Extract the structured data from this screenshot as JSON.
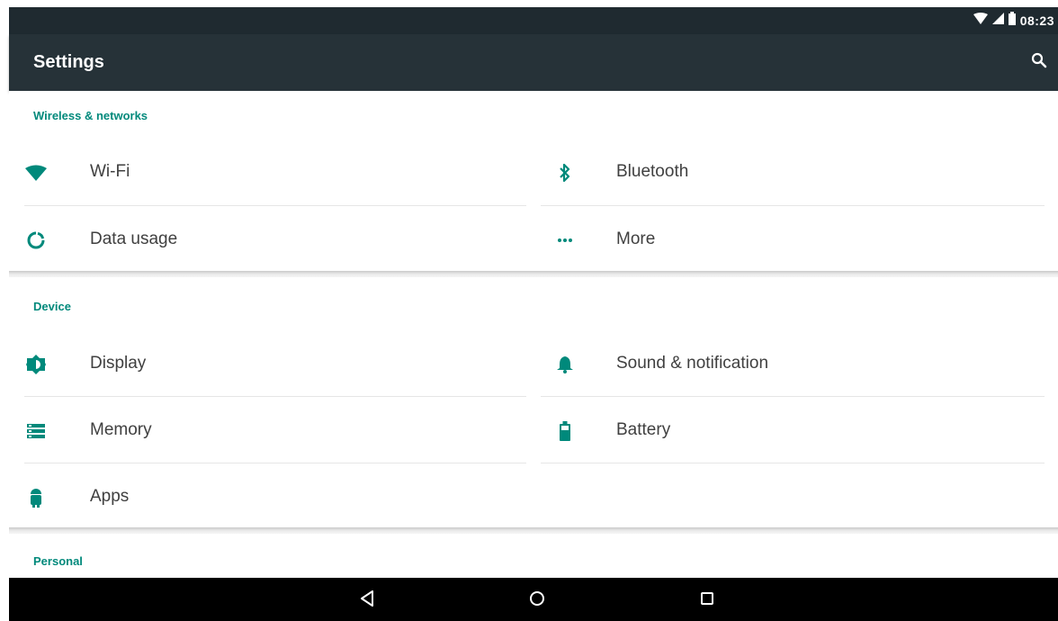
{
  "status": {
    "time": "08:23"
  },
  "app_bar": {
    "title": "Settings"
  },
  "sections": {
    "wireless": {
      "header": "Wireless & networks",
      "items": [
        {
          "label": "Wi-Fi",
          "icon": "wifi-icon"
        },
        {
          "label": "Bluetooth",
          "icon": "bluetooth-icon"
        },
        {
          "label": "Data usage",
          "icon": "data-usage-icon"
        },
        {
          "label": "More",
          "icon": "more-icon"
        }
      ]
    },
    "device": {
      "header": "Device",
      "items": [
        {
          "label": "Display",
          "icon": "display-brightness-icon"
        },
        {
          "label": "Sound & notification",
          "icon": "bell-icon"
        },
        {
          "label": "Memory",
          "icon": "memory-icon"
        },
        {
          "label": "Battery",
          "icon": "battery-icon"
        },
        {
          "label": "Apps",
          "icon": "android-apps-icon"
        }
      ]
    },
    "personal": {
      "header": "Personal"
    }
  },
  "colors": {
    "accent": "#00897b",
    "app_bar": "#263238",
    "status_bar": "#1f2a30",
    "nav_bar": "#000000"
  }
}
